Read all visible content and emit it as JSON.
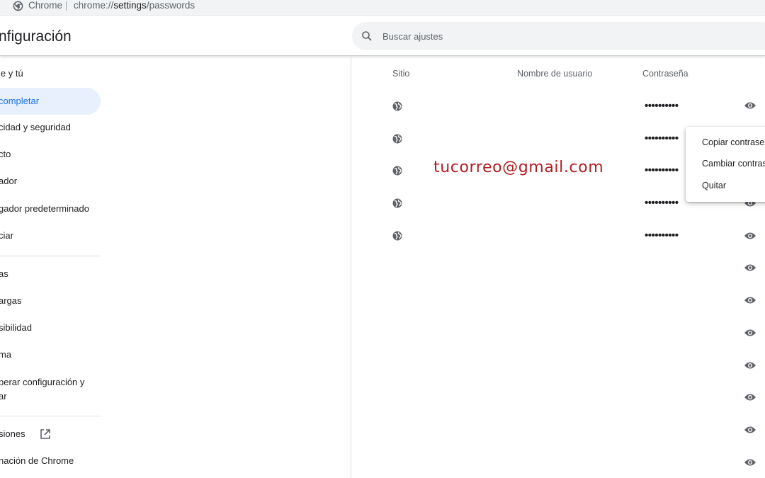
{
  "addressbar": {
    "browser_label": "Chrome",
    "url_prefix": "chrome://",
    "url_host": "settings",
    "url_path": "/passwords"
  },
  "header": {
    "title": "nfiguración",
    "search_placeholder": "Buscar ajustes"
  },
  "sidebar": {
    "items": [
      {
        "label": "le y tú"
      },
      {
        "label": "completar",
        "active": true
      },
      {
        "label": "cidad y seguridad"
      },
      {
        "label": "cto"
      },
      {
        "label": "ador"
      },
      {
        "label": "gador predeterminado"
      },
      {
        "label": "ciar"
      },
      {
        "label": "as"
      },
      {
        "label": "argas"
      },
      {
        "label": "sibilidad"
      },
      {
        "label": "ma"
      },
      {
        "label": "perar configuración y\nar"
      },
      {
        "label": "siones"
      },
      {
        "label": "nación de Chrome"
      }
    ]
  },
  "passwords": {
    "columns": {
      "site": "Sitio",
      "username": "Nombre de usuario",
      "password": "Contraseña"
    },
    "masked": "••••••••••",
    "username_overlay": "tucorreo@gmail.com"
  },
  "menu": {
    "items": [
      "Copiar contraseña",
      "Cambiar contraseña",
      "Quitar"
    ]
  },
  "colors": {
    "accent": "#1a73e8",
    "active_bg": "#e8f0fe",
    "overlay_text": "#b31e24"
  }
}
